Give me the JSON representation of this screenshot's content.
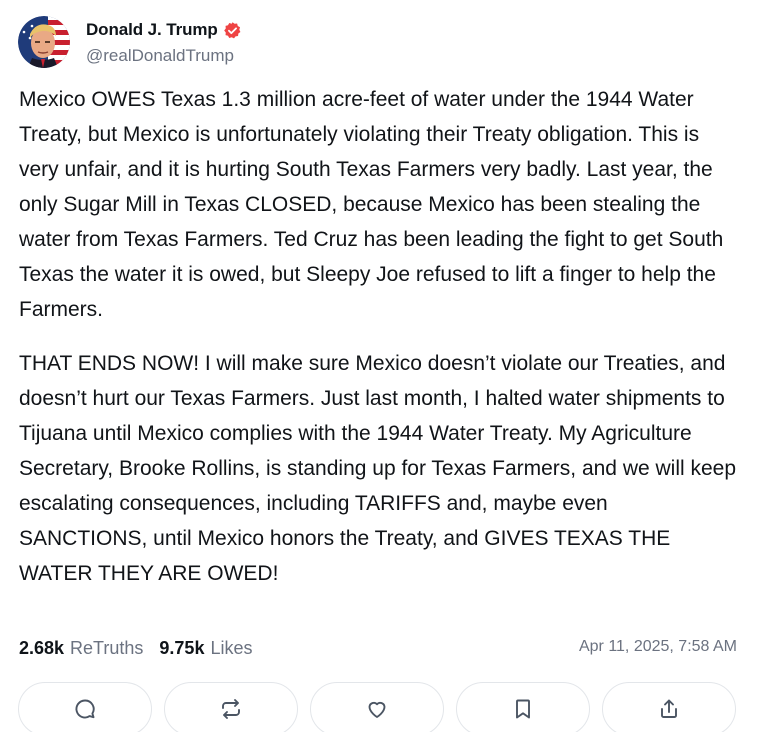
{
  "author": {
    "display_name": "Donald J. Trump",
    "handle": "@realDonaldTrump",
    "verified": true,
    "verified_color": "#ef4444"
  },
  "post": {
    "paragraphs": [
      "Mexico OWES Texas 1.3 million acre-feet of water under the 1944 Water Treaty, but Mexico is unfortunately violating their Treaty obligation. This is very unfair, and it is hurting South Texas Farmers very badly. Last year, the only Sugar Mill in Texas CLOSED, because Mexico has been stealing the water from Texas Farmers. Ted Cruz has been leading the fight to get South Texas the water it is owed, but Sleepy Joe refused to lift a finger to help the Farmers.",
      "THAT ENDS NOW! I will make sure Mexico doesn’t violate our Treaties, and doesn’t hurt our Texas Farmers. Just last month, I halted water shipments to Tijuana until Mexico complies with the 1944 Water Treaty. My Agriculture Secretary, Brooke Rollins, is standing up for Texas Farmers, and we will keep escalating consequences, including TARIFFS and, maybe even SANCTIONS, until Mexico honors the Treaty, and GIVES TEXAS THE WATER THEY ARE OWED!"
    ],
    "timestamp": "Apr 11, 2025, 7:58 AM"
  },
  "stats": {
    "retruths_count": "2.68k",
    "retruths_label": "ReTruths",
    "likes_count": "9.75k",
    "likes_label": "Likes"
  },
  "actions": [
    {
      "icon": "reply-icon"
    },
    {
      "icon": "retruth-icon"
    },
    {
      "icon": "like-icon"
    },
    {
      "icon": "bookmark-icon"
    },
    {
      "icon": "share-icon"
    }
  ],
  "colors": {
    "text": "#0f1419",
    "muted": "#6b7280",
    "border": "#e3e6ea",
    "icon": "#4b5563"
  }
}
